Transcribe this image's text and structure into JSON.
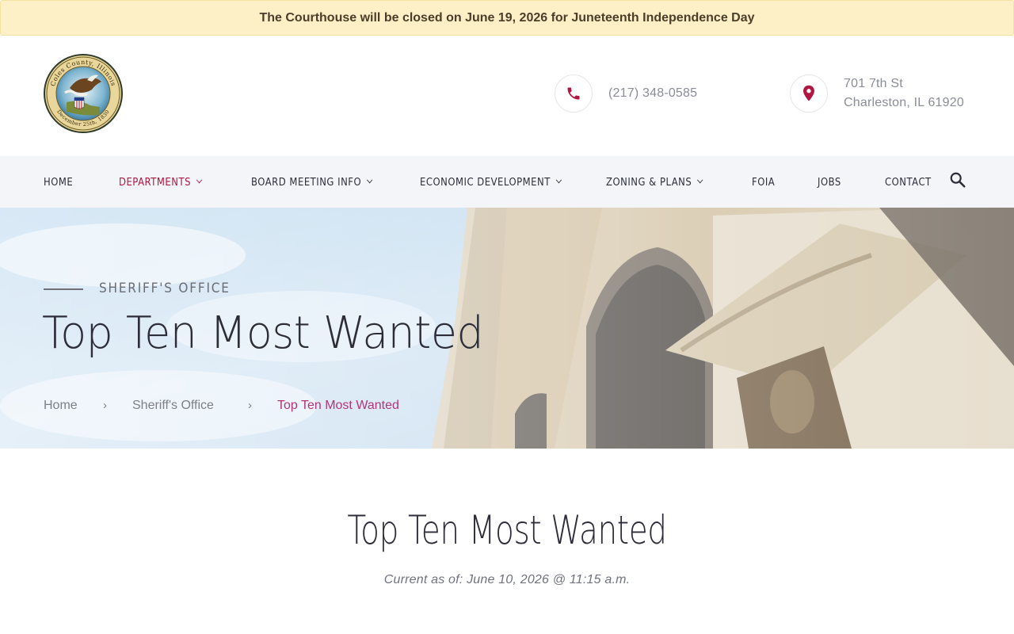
{
  "alert": {
    "text": "The Courthouse will be closed on June 19, 2026 for Juneteenth Independence Day"
  },
  "header": {
    "seal_text_top": "Coles County, Illinois",
    "seal_text_bottom": "December 25th, 1830",
    "phone": "(217) 348-0585",
    "address_line1": "701 7th St",
    "address_line2": "Charleston, IL 61920",
    "accent_color": "#b0163f"
  },
  "nav": {
    "items": [
      {
        "label": "HOME"
      },
      {
        "label": "DEPARTMENTS"
      },
      {
        "label": "BOARD MEETING INFO"
      },
      {
        "label": "ECONOMIC DEVELOPMENT"
      },
      {
        "label": "ZONING & PLANS"
      },
      {
        "label": "FOIA"
      },
      {
        "label": "JOBS"
      },
      {
        "label": "CONTACT"
      }
    ],
    "active": "DEPARTMENTS",
    "search_icon": "search-icon"
  },
  "hero": {
    "eyebrow": "SHERIFF'S OFFICE",
    "title": "Top Ten Most Wanted",
    "breadcrumb": {
      "home": "Home",
      "parent": "Sheriff's Office",
      "current": "Top Ten Most Wanted",
      "separator": "›"
    }
  },
  "content": {
    "title": "Top Ten Most Wanted",
    "current_as_of": "Current as of: June 10, 2026 @ 11:15 a.m."
  }
}
